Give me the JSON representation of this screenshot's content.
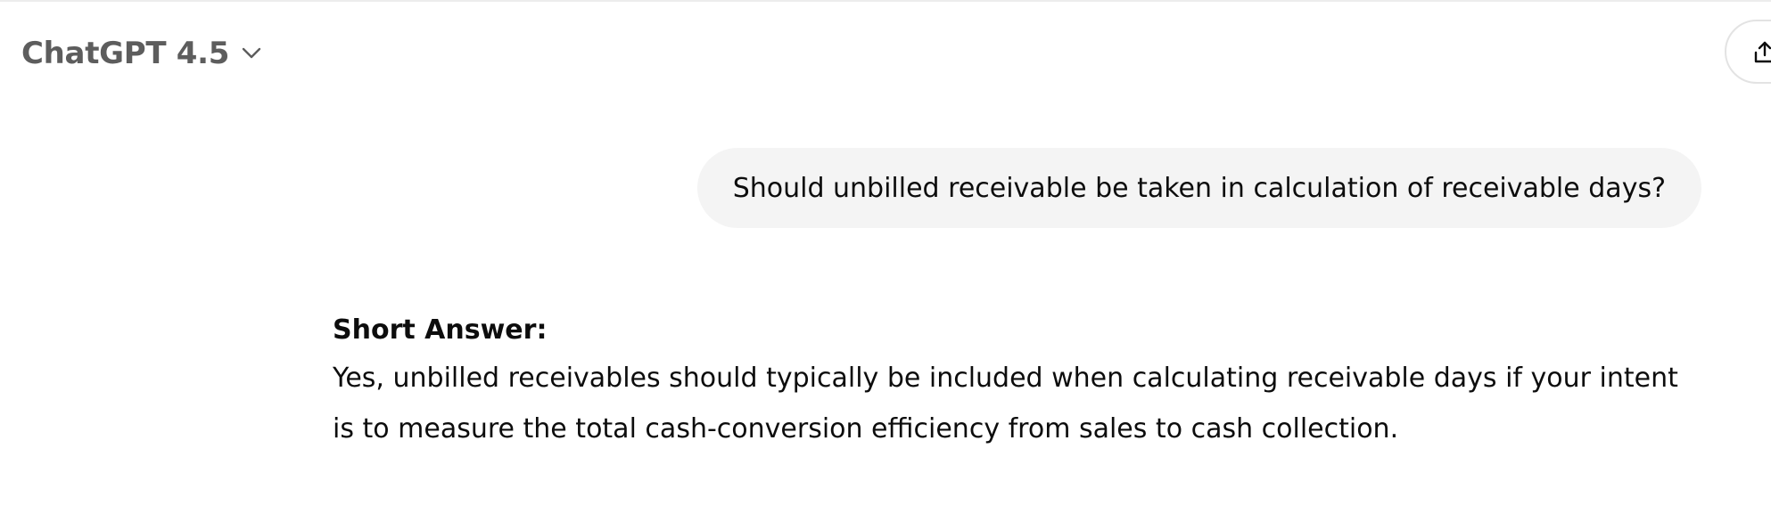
{
  "header": {
    "model_name": "ChatGPT 4.5",
    "icons": {
      "model_dropdown": "chevron-down-icon",
      "share": "share-icon"
    }
  },
  "conversation": {
    "user_message": "Should unbilled receivable be taken in calculation of receivable days?",
    "assistant_message": {
      "heading": "Short Answer:",
      "body": "Yes, unbilled receivables should typically be included when calculating receivable days if your intent is to measure the total cash-conversion efficiency from sales to cash collection."
    }
  },
  "colors": {
    "user_bubble_bg": "#f4f4f4",
    "model_name_text": "#5d5d5d",
    "body_text": "#0d0d0d"
  }
}
